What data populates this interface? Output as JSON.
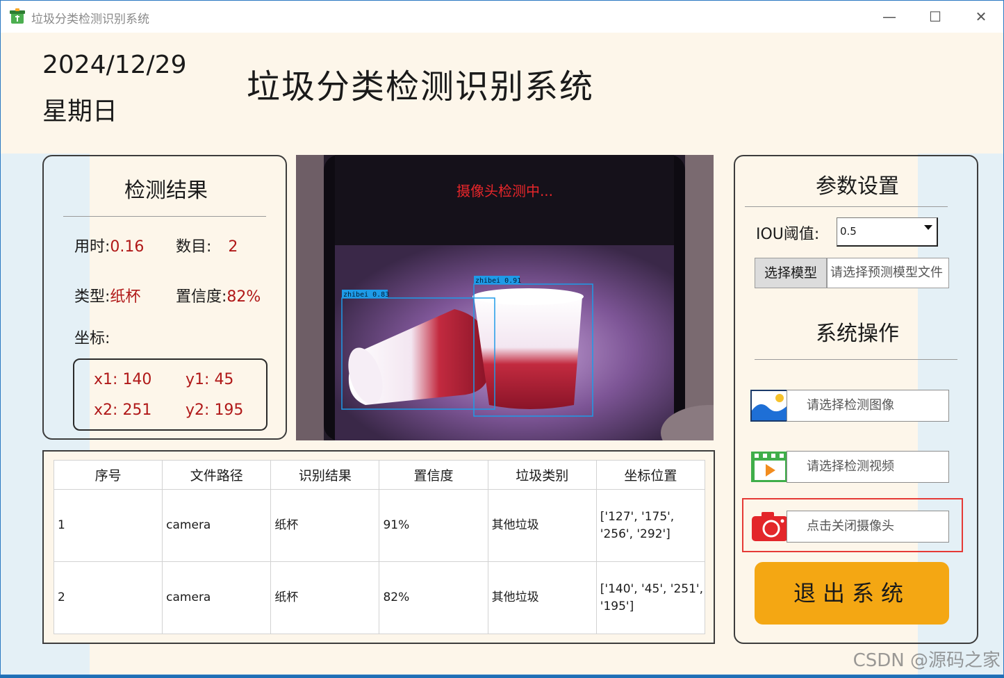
{
  "window": {
    "title": "垃圾分类检测识别系统",
    "minimize_label": "—",
    "maximize_label": "☐",
    "close_label": "✕"
  },
  "header": {
    "date": "2024/12/29",
    "weekday": "星期日",
    "title": "垃圾分类检测识别系统"
  },
  "results_panel": {
    "title": "检测结果",
    "time_label": "用时:",
    "time_value": "0.16",
    "count_label": "数目:",
    "count_value": "2",
    "type_label": "类型:",
    "type_value": "纸杯",
    "conf_label": "置信度:",
    "conf_value": "82%",
    "coords_label": "坐标:",
    "x1_label": "x1:",
    "x1_value": "140",
    "y1_label": "y1:",
    "y1_value": "45",
    "x2_label": "x2:",
    "x2_value": "251",
    "y2_label": "y2:",
    "y2_value": "195"
  },
  "camera": {
    "status": "摄像头检测中...",
    "detections": [
      {
        "label": "zhibei 0.83"
      },
      {
        "label": "zhibei 0.91"
      }
    ]
  },
  "table": {
    "headers": [
      "序号",
      "文件路径",
      "识别结果",
      "置信度",
      "垃圾类别",
      "坐标位置"
    ],
    "rows": [
      {
        "index": "1",
        "path": "camera",
        "result": "纸杯",
        "confidence": "91%",
        "category": "其他垃圾",
        "coords_line1": "['127', '175',",
        "coords_line2": "'256', '292']"
      },
      {
        "index": "2",
        "path": "camera",
        "result": "纸杯",
        "confidence": "82%",
        "category": "其他垃圾",
        "coords_line1": "['140', '45', '251',",
        "coords_line2": "'195']"
      }
    ]
  },
  "params_panel": {
    "title": "参数设置",
    "iou_label": "IOU阈值:",
    "iou_value": "0.5",
    "model_button": "选择模型",
    "model_field": "请选择预测模型文件"
  },
  "ops_panel": {
    "title": "系统操作",
    "image_field": "请选择检测图像",
    "video_field": "请选择检测视频",
    "camera_field": "点击关闭摄像头",
    "exit_button": "退出系统"
  },
  "watermark": "CSDN @源码之家",
  "colors": {
    "accent_red": "#b01818",
    "status_red": "#e8262a",
    "exit_orange": "#f4a713",
    "highlight_red": "#e53935",
    "box_blue": "#1e9be8"
  }
}
